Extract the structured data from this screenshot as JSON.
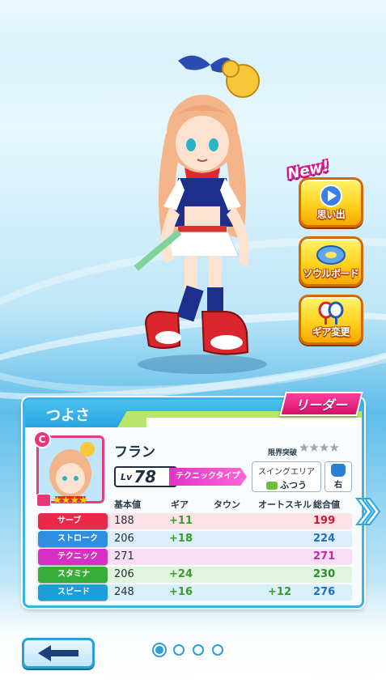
{
  "side_buttons": {
    "new_badge": "New!",
    "memories": "思い出",
    "soul_board": "ソウルボード",
    "gear_change": "ギア変更"
  },
  "panel": {
    "title": "つよさ",
    "leader": "リーダー",
    "rarity": "C",
    "stars": 4,
    "name": "フラン",
    "limit_break_label": "限界突破",
    "limit_break_stars": 4,
    "level_prefix": "Lv",
    "level": "78",
    "type": "テクニックタイプ",
    "swing_area_label": "スイングエリア",
    "swing_area_value": "ふつう",
    "hand": "右",
    "headers": {
      "base": "基本値",
      "gear": "ギア",
      "town": "タウン",
      "auto_skill": "オートスキル",
      "total": "総合値"
    },
    "stats": [
      {
        "name": "サーブ",
        "base": "188",
        "gear": "+11",
        "town": "",
        "auto": "",
        "total": "199",
        "color": "#e8294a",
        "row_bg": "#fde3e8",
        "total_color": "#d1172e"
      },
      {
        "name": "ストローク",
        "base": "206",
        "gear": "+18",
        "town": "",
        "auto": "",
        "total": "224",
        "color": "#2e8fe0",
        "row_bg": "#dceefb",
        "total_color": "#1f6fbf"
      },
      {
        "name": "テクニック",
        "base": "271",
        "gear": "",
        "town": "",
        "auto": "",
        "total": "271",
        "color": "#d72fc4",
        "row_bg": "#f9def4",
        "total_color": "#c22aa8"
      },
      {
        "name": "スタミナ",
        "base": "206",
        "gear": "+24",
        "town": "",
        "auto": "",
        "total": "230",
        "color": "#39ad3a",
        "row_bg": "#e0f4de",
        "total_color": "#2a8d2b"
      },
      {
        "name": "スピード",
        "base": "248",
        "gear": "+16",
        "town": "",
        "auto": "+12",
        "total": "276",
        "color": "#1b9fd6",
        "row_bg": "#d9f0fb",
        "total_color": "#1f6fbf"
      }
    ]
  },
  "pager": {
    "count": 4,
    "active": 0
  },
  "icons": {
    "back": "left-arrow-icon",
    "next": "double-chevron-right-icon",
    "memories": "play-icon",
    "soul_board": "soul-disc-icon",
    "gear": "racket-icon"
  }
}
